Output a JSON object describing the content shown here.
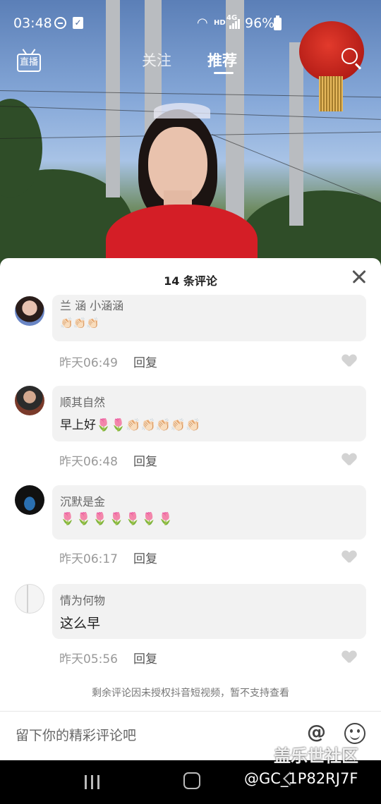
{
  "status_bar": {
    "time": "03:48",
    "network": "HD",
    "signal_label": "4G",
    "battery": "96%"
  },
  "top_nav": {
    "live": "直播",
    "tabs": [
      {
        "label": "关注"
      },
      {
        "label": "推荐"
      }
    ]
  },
  "sheet": {
    "title": "14 条评论",
    "comments": [
      {
        "user": "兰 涵 小涵涵",
        "text": "👏🏻👏🏻👏🏻",
        "time": "昨天06:49",
        "reply": "回复"
      },
      {
        "user": "顺其自然",
        "text": "早上好🌷🌷👏🏻👏🏻👏🏻👏🏻👏🏻",
        "time": "昨天06:48",
        "reply": "回复"
      },
      {
        "user": "沉默是金",
        "text": "🌷🌷🌷🌷🌷🌷🌷",
        "time": "昨天06:17",
        "reply": "回复"
      },
      {
        "user": "情为何物",
        "text": "这么早",
        "time": "昨天05:56",
        "reply": "回复"
      }
    ],
    "footer_note": "剩余评论因未授权抖音短视频，暂不支持查看",
    "input_placeholder": "留下你的精彩评论吧"
  },
  "watermark": {
    "title": "盖乐世社区",
    "id": "@GC_1P82RJ7F"
  },
  "icons": [
    "live-icon",
    "search-icon",
    "close-icon",
    "heart-icon",
    "at-icon",
    "emoji-icon",
    "recents-icon",
    "home-icon",
    "back-icon"
  ]
}
